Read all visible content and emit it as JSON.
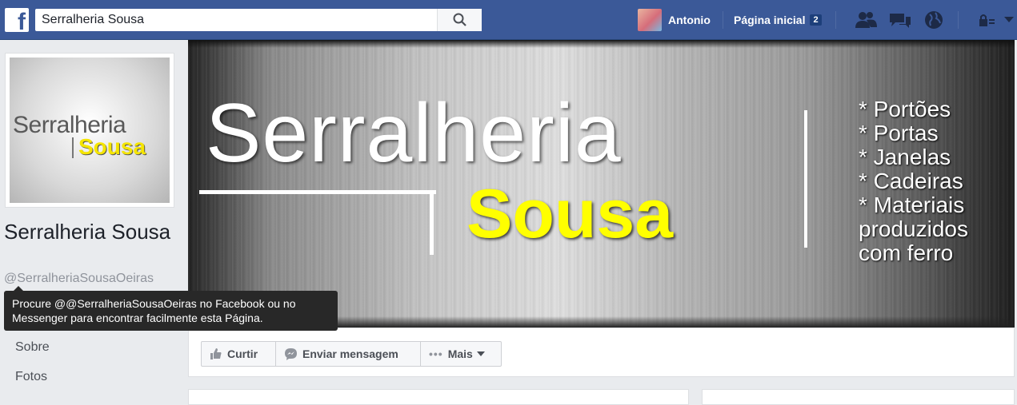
{
  "topbar": {
    "logo_letter": "f",
    "search_value": "Serralheria Sousa",
    "user_name": "Antonio",
    "home_label": "Página inicial",
    "home_badge": "2",
    "bg_color": "#3b5998"
  },
  "left": {
    "profile_text_line1": "Serralheria",
    "profile_text_line2": "Sousa",
    "page_name": "Serralheria Sousa",
    "page_handle": "@SerralheriaSousaOeiras",
    "tooltip": "Procure @@SerralheriaSousaOeiras no Facebook ou no Messenger para encontrar facilmente esta Página.",
    "nav": [
      "Sobre",
      "Fotos"
    ]
  },
  "cover": {
    "title_line1": "Serralheria",
    "title_line2": "Sousa",
    "list": [
      "* Portões",
      "* Portas",
      "* Janelas",
      "* Cadeiras",
      "* Materiais",
      "produzidos",
      "com ferro"
    ]
  },
  "actions": {
    "like_label": "Curtir",
    "message_label": "Enviar mensagem",
    "more_label": "Mais"
  }
}
